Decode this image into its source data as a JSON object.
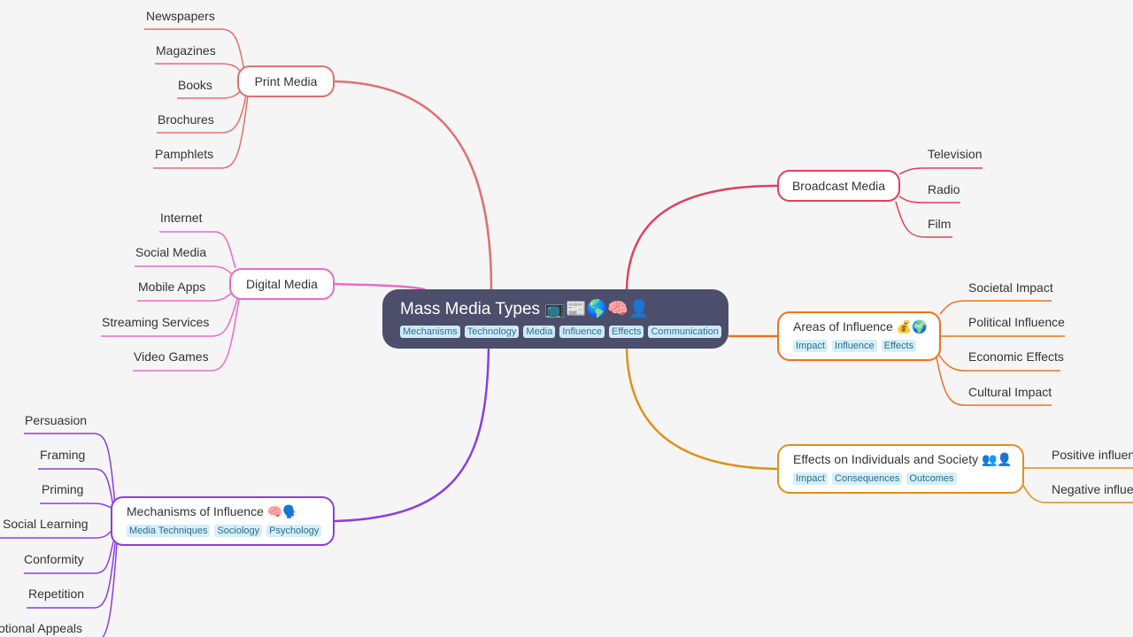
{
  "root": {
    "title": "Mass Media Types",
    "emoji": "📺📰🌎🧠👤",
    "tags": [
      "Mechanisms",
      "Technology",
      "Media",
      "Influence",
      "Effects",
      "Communication"
    ]
  },
  "branches": {
    "print": {
      "title": "Print Media",
      "color": "#e07070",
      "children": [
        "Newspapers",
        "Magazines",
        "Books",
        "Brochures",
        "Pamphlets"
      ]
    },
    "digital": {
      "title": "Digital Media",
      "color": "#e86cc8",
      "children": [
        "Internet",
        "Social Media",
        "Mobile Apps",
        "Streaming Services",
        "Video Games"
      ]
    },
    "mechanisms": {
      "title": "Mechanisms of Influence",
      "emoji": "🧠🗣️",
      "color": "#8a3fe0",
      "tags": [
        "Media Techniques",
        "Sociology",
        "Psychology"
      ],
      "children": [
        "Persuasion",
        "Framing",
        "Priming",
        "Social Learning",
        "Conformity",
        "Repetition",
        "Emotional Appeals"
      ]
    },
    "broadcast": {
      "title": "Broadcast Media",
      "color": "#e0405a",
      "children": [
        "Television",
        "Radio",
        "Film"
      ]
    },
    "areas": {
      "title": "Areas of Influence",
      "emoji": "💰🌍",
      "color": "#f07020",
      "tags": [
        "Impact",
        "Influence",
        "Effects"
      ],
      "children": [
        "Societal Impact",
        "Political Influence",
        "Economic Effects",
        "Cultural Impact"
      ]
    },
    "effects": {
      "title": "Effects on Individuals and Society",
      "emoji": "👥👤",
      "color": "#e0901a",
      "tags": [
        "Impact",
        "Consequences",
        "Outcomes"
      ],
      "children": [
        "Positive influence",
        "Negative influence"
      ]
    }
  }
}
